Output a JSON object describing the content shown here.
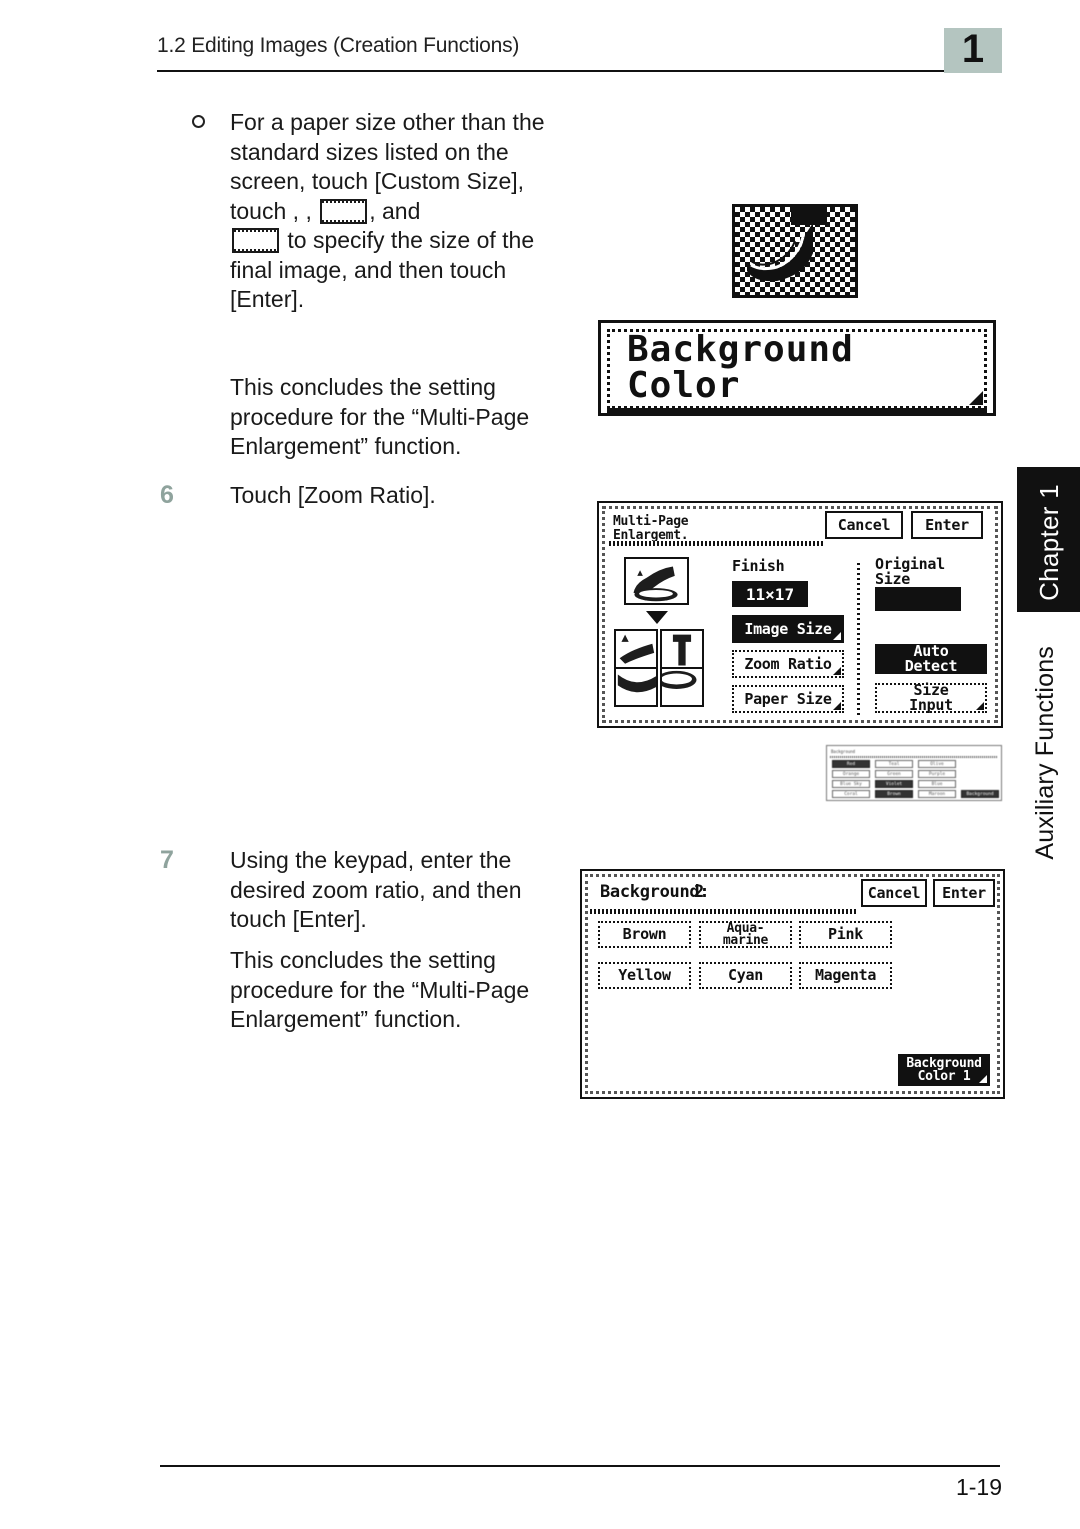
{
  "header": {
    "section_title": "1.2 Editing Images (Creation Functions)",
    "chapter_marker": "1"
  },
  "side_tab": {
    "chapter_label": "Chapter 1",
    "section_label": "Auxiliary Functions"
  },
  "body": {
    "bullet": {
      "marker_icon": "open-circle-bullet",
      "text_part_1": "For a paper size other than the standard sizes listed on the screen, touch [Custom Size], touch ",
      "comma_1": ", ",
      "comma_2": ", ",
      "icon_down_name": "decrease-key-icon",
      "icon_up_name": "increase-key-icon",
      "text_part_2": ", and ",
      "text_part_3": " to specify the size of the final image, and then touch [Enter]."
    },
    "conclude_1": "This concludes the setting procedure for the “Multi-Page Enlargement” function.",
    "step_6": {
      "number": "6",
      "text": "Touch [Zoom Ratio]."
    },
    "step_7": {
      "number": "7",
      "text": "Using the keypad, enter the desired zoom ratio, and then touch [Enter]."
    },
    "conclude_2": "This concludes the setting procedure for the “Multi-Page Enlargement” function."
  },
  "figures": {
    "dot_icon": {
      "name": "halftone-banana-icon"
    },
    "banner": {
      "line1": "Background",
      "line2": "Color"
    }
  },
  "lcd_multipage": {
    "title": "Multi-Page\nEnlargemt.",
    "cancel_label": "Cancel",
    "enter_label": "Enter",
    "finish_label": "Finish",
    "finish_value": "11×17",
    "original_size_label": "Original\nSize",
    "original_size_value": "",
    "buttons": [
      {
        "label": "Image Size",
        "state": "selected"
      },
      {
        "label": "Zoom Ratio",
        "state": "normal"
      },
      {
        "label": "Paper Size",
        "state": "normal"
      }
    ],
    "right_buttons": [
      {
        "label": "Auto\nDetect",
        "state": "selected"
      },
      {
        "label": "Size\nInput",
        "state": "normal"
      }
    ]
  },
  "lcd_mini": {
    "title": "Background",
    "rows": [
      [
        "Red",
        "Teal",
        "Olive"
      ],
      [
        "Orange",
        "Green",
        "Purple"
      ],
      [
        "Blue Sky",
        "Violet",
        "Blue"
      ],
      [
        "Coral",
        "Brown",
        "Maroon"
      ]
    ],
    "corner_button": "Background"
  },
  "lcd_background": {
    "title_label": "Background:",
    "title_value": "2",
    "cancel_label": "Cancel",
    "enter_label": "Enter",
    "color_buttons": [
      "Brown",
      "Aqua-\nmarine",
      "Pink",
      "Yellow",
      "Cyan",
      "Magenta"
    ],
    "page_button": "Background\nColor  1"
  },
  "footer": {
    "page_number": "1-19"
  }
}
